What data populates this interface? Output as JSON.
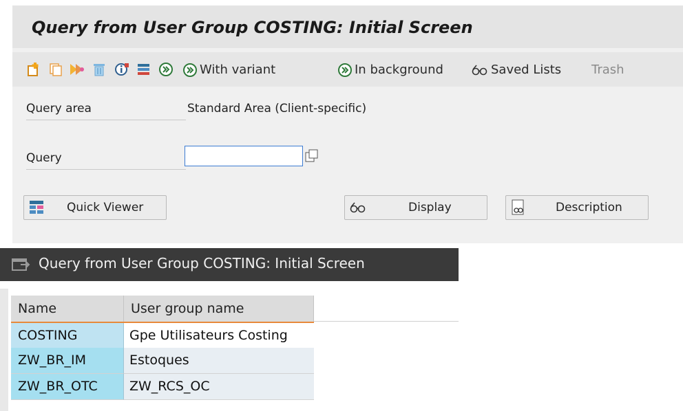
{
  "screen": {
    "title": "Query from User Group COSTING: Initial Screen",
    "toolbar": {
      "icons": [
        "create-icon",
        "copy-icon",
        "change-icon",
        "delete-icon",
        "infoset-icon",
        "query-list-icon",
        "execute-icon"
      ],
      "with_variant": "With variant",
      "in_background": "In background",
      "saved_lists": "Saved Lists",
      "trash": "Trash"
    },
    "query_area_label": "Query area",
    "query_area_value": "Standard Area (Client-specific)",
    "query_label": "Query",
    "query_value": "",
    "buttons": {
      "quick_viewer": "Quick Viewer",
      "display": "Display",
      "description": "Description"
    }
  },
  "popup": {
    "title": "Query from User Group COSTING: Initial Screen",
    "columns": [
      "Name",
      "User group name"
    ],
    "rows": [
      {
        "name": "COSTING",
        "group": "Gpe Utilisateurs Costing"
      },
      {
        "name": "ZW_BR_IM",
        "group": "Estoques"
      },
      {
        "name": "ZW_BR_OTC",
        "group": "ZW_RCS_OC"
      }
    ]
  },
  "colors": {
    "selection_border": "#e8893a",
    "key_column": "#bfe3f2",
    "popup_titlebar": "#3a3a3a"
  }
}
